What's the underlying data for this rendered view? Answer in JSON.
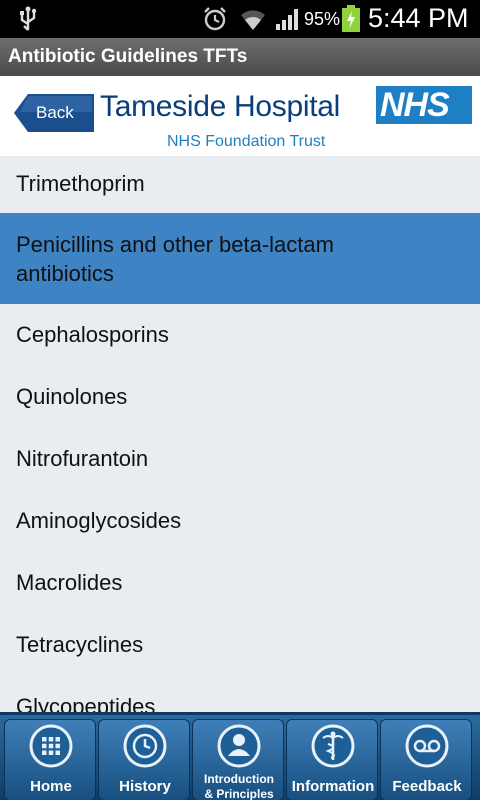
{
  "status_bar": {
    "battery_percent": "95%",
    "time": "5:44 PM",
    "icons": [
      "usb-icon",
      "alarm-icon",
      "wifi-icon",
      "signal-icon",
      "battery-charging-icon"
    ]
  },
  "app": {
    "title": "Antibiotic Guidelines TFTs"
  },
  "header": {
    "back_label": "Back",
    "hospital_name": "Tameside Hospital",
    "trust_name": "NHS Foundation Trust",
    "logo_text": "NHS",
    "colors": {
      "nhs_blue": "#1f7fc4",
      "navy": "#0a3d7a"
    }
  },
  "list": {
    "selected_index": 1,
    "selected_color": "#3e83c3",
    "items": [
      {
        "label": "Trimethoprim"
      },
      {
        "label": "Penicillins and other beta-lactam",
        "label2": "antibiotics"
      },
      {
        "label": "Cephalosporins"
      },
      {
        "label": "Quinolones"
      },
      {
        "label": "Nitrofurantoin"
      },
      {
        "label": "Aminoglycosides"
      },
      {
        "label": "Macrolides"
      },
      {
        "label": "Tetracyclines"
      },
      {
        "label": "Glycopeptides"
      }
    ]
  },
  "tabbar": {
    "tabs": [
      {
        "label": "Home",
        "icon": "grid-icon"
      },
      {
        "label": "History",
        "icon": "clock-icon"
      },
      {
        "label": "Introduction",
        "label2": "& Principles",
        "icon": "person-icon"
      },
      {
        "label": "Information",
        "icon": "caduceus-icon"
      },
      {
        "label": "Feedback",
        "icon": "voicemail-icon"
      }
    ]
  }
}
